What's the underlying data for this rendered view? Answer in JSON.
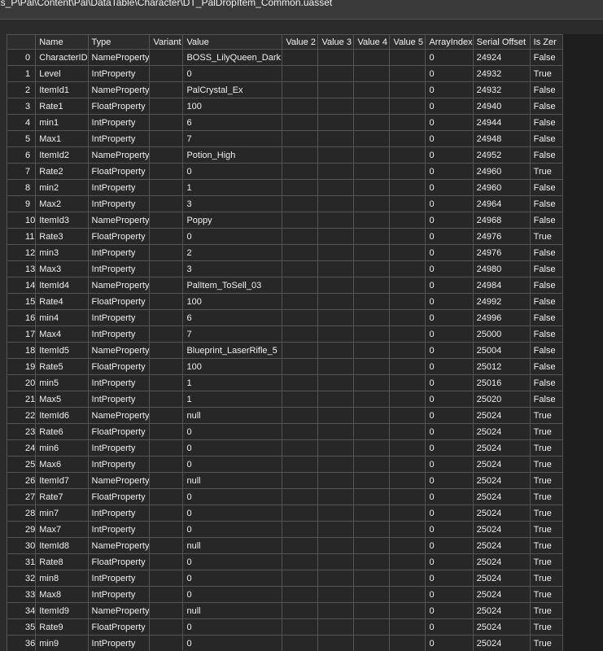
{
  "window": {
    "title": "us_P\\Pal\\Content\\Pal\\DataTable\\Character\\DT_PalDropItem_Common.uasset"
  },
  "grid": {
    "columns": [
      "",
      "Name",
      "Type",
      "Variant",
      "Value",
      "Value 2",
      "Value 3",
      "Value 4",
      "Value 5",
      "ArrayIndex",
      "Serial Offset",
      "Is Zer"
    ],
    "rows": [
      [
        "0",
        "CharacterID",
        "NameProperty",
        "",
        "BOSS_LilyQueen_Dark",
        "",
        "",
        "",
        "",
        "0",
        "24924",
        "False"
      ],
      [
        "1",
        "Level",
        "IntProperty",
        "",
        "0",
        "",
        "",
        "",
        "",
        "0",
        "24932",
        "True"
      ],
      [
        "2",
        "ItemId1",
        "NameProperty",
        "",
        "PalCrystal_Ex",
        "",
        "",
        "",
        "",
        "0",
        "24932",
        "False"
      ],
      [
        "3",
        "Rate1",
        "FloatProperty",
        "",
        "100",
        "",
        "",
        "",
        "",
        "0",
        "24940",
        "False"
      ],
      [
        "4",
        "min1",
        "IntProperty",
        "",
        "6",
        "",
        "",
        "",
        "",
        "0",
        "24944",
        "False"
      ],
      [
        "5",
        "Max1",
        "IntProperty",
        "",
        "7",
        "",
        "",
        "",
        "",
        "0",
        "24948",
        "False"
      ],
      [
        "6",
        "ItemId2",
        "NameProperty",
        "",
        "Potion_High",
        "",
        "",
        "",
        "",
        "0",
        "24952",
        "False"
      ],
      [
        "7",
        "Rate2",
        "FloatProperty",
        "",
        "0",
        "",
        "",
        "",
        "",
        "0",
        "24960",
        "True"
      ],
      [
        "8",
        "min2",
        "IntProperty",
        "",
        "1",
        "",
        "",
        "",
        "",
        "0",
        "24960",
        "False"
      ],
      [
        "9",
        "Max2",
        "IntProperty",
        "",
        "3",
        "",
        "",
        "",
        "",
        "0",
        "24964",
        "False"
      ],
      [
        "10",
        "ItemId3",
        "NameProperty",
        "",
        "Poppy",
        "",
        "",
        "",
        "",
        "0",
        "24968",
        "False"
      ],
      [
        "11",
        "Rate3",
        "FloatProperty",
        "",
        "0",
        "",
        "",
        "",
        "",
        "0",
        "24976",
        "True"
      ],
      [
        "12",
        "min3",
        "IntProperty",
        "",
        "2",
        "",
        "",
        "",
        "",
        "0",
        "24976",
        "False"
      ],
      [
        "13",
        "Max3",
        "IntProperty",
        "",
        "3",
        "",
        "",
        "",
        "",
        "0",
        "24980",
        "False"
      ],
      [
        "14",
        "ItemId4",
        "NameProperty",
        "",
        "PalItem_ToSell_03",
        "",
        "",
        "",
        "",
        "0",
        "24984",
        "False"
      ],
      [
        "15",
        "Rate4",
        "FloatProperty",
        "",
        "100",
        "",
        "",
        "",
        "",
        "0",
        "24992",
        "False"
      ],
      [
        "16",
        "min4",
        "IntProperty",
        "",
        "6",
        "",
        "",
        "",
        "",
        "0",
        "24996",
        "False"
      ],
      [
        "17",
        "Max4",
        "IntProperty",
        "",
        "7",
        "",
        "",
        "",
        "",
        "0",
        "25000",
        "False"
      ],
      [
        "18",
        "ItemId5",
        "NameProperty",
        "",
        "Blueprint_LaserRifle_5",
        "",
        "",
        "",
        "",
        "0",
        "25004",
        "False"
      ],
      [
        "19",
        "Rate5",
        "FloatProperty",
        "",
        "100",
        "",
        "",
        "",
        "",
        "0",
        "25012",
        "False"
      ],
      [
        "20",
        "min5",
        "IntProperty",
        "",
        "1",
        "",
        "",
        "",
        "",
        "0",
        "25016",
        "False"
      ],
      [
        "21",
        "Max5",
        "IntProperty",
        "",
        "1",
        "",
        "",
        "",
        "",
        "0",
        "25020",
        "False"
      ],
      [
        "22",
        "ItemId6",
        "NameProperty",
        "",
        "null",
        "",
        "",
        "",
        "",
        "0",
        "25024",
        "True"
      ],
      [
        "23",
        "Rate6",
        "FloatProperty",
        "",
        "0",
        "",
        "",
        "",
        "",
        "0",
        "25024",
        "True"
      ],
      [
        "24",
        "min6",
        "IntProperty",
        "",
        "0",
        "",
        "",
        "",
        "",
        "0",
        "25024",
        "True"
      ],
      [
        "25",
        "Max6",
        "IntProperty",
        "",
        "0",
        "",
        "",
        "",
        "",
        "0",
        "25024",
        "True"
      ],
      [
        "26",
        "ItemId7",
        "NameProperty",
        "",
        "null",
        "",
        "",
        "",
        "",
        "0",
        "25024",
        "True"
      ],
      [
        "27",
        "Rate7",
        "FloatProperty",
        "",
        "0",
        "",
        "",
        "",
        "",
        "0",
        "25024",
        "True"
      ],
      [
        "28",
        "min7",
        "IntProperty",
        "",
        "0",
        "",
        "",
        "",
        "",
        "0",
        "25024",
        "True"
      ],
      [
        "29",
        "Max7",
        "IntProperty",
        "",
        "0",
        "",
        "",
        "",
        "",
        "0",
        "25024",
        "True"
      ],
      [
        "30",
        "ItemId8",
        "NameProperty",
        "",
        "null",
        "",
        "",
        "",
        "",
        "0",
        "25024",
        "True"
      ],
      [
        "31",
        "Rate8",
        "FloatProperty",
        "",
        "0",
        "",
        "",
        "",
        "",
        "0",
        "25024",
        "True"
      ],
      [
        "32",
        "min8",
        "IntProperty",
        "",
        "0",
        "",
        "",
        "",
        "",
        "0",
        "25024",
        "True"
      ],
      [
        "33",
        "Max8",
        "IntProperty",
        "",
        "0",
        "",
        "",
        "",
        "",
        "0",
        "25024",
        "True"
      ],
      [
        "34",
        "ItemId9",
        "NameProperty",
        "",
        "null",
        "",
        "",
        "",
        "",
        "0",
        "25024",
        "True"
      ],
      [
        "35",
        "Rate9",
        "FloatProperty",
        "",
        "0",
        "",
        "",
        "",
        "",
        "0",
        "25024",
        "True"
      ],
      [
        "36",
        "min9",
        "IntProperty",
        "",
        "0",
        "",
        "",
        "",
        "",
        "0",
        "25024",
        "True"
      ]
    ]
  }
}
